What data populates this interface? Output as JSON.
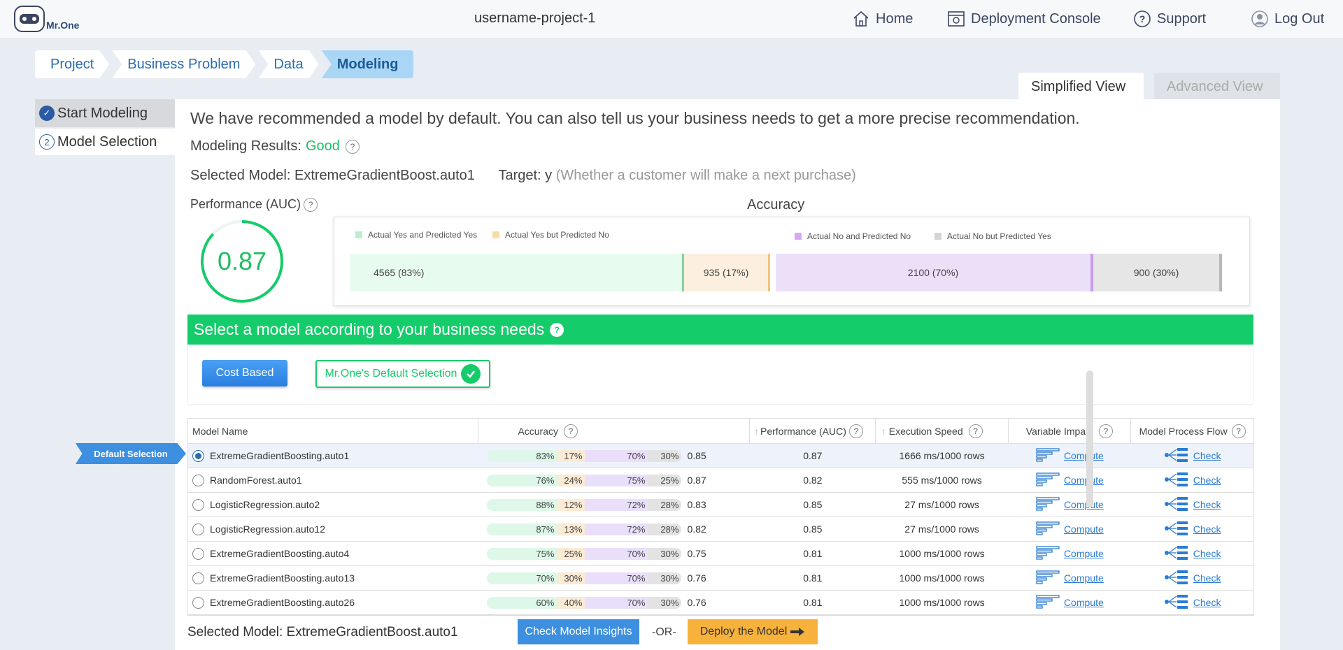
{
  "header": {
    "logo_text": "Mr.One",
    "project_name": "username-project-1",
    "nav": [
      {
        "label": "Home",
        "icon": "home-icon"
      },
      {
        "label": "Deployment Console",
        "icon": "console-icon"
      },
      {
        "label": "Support",
        "icon": "help-icon"
      },
      {
        "label": "Log Out",
        "icon": "user-icon"
      }
    ]
  },
  "breadcrumb": [
    "Project",
    "Business Problem",
    "Data",
    "Modeling"
  ],
  "view_tabs": {
    "simplified": "Simplified View",
    "advanced": "Advanced View"
  },
  "sidenav": [
    {
      "label": "Start Modeling",
      "state": "done"
    },
    {
      "label": "Model Selection",
      "step": "2"
    }
  ],
  "main": {
    "recommendation": "We have recommended a model by default. You can also tell us your business needs to get a more precise recommendation.",
    "results_label": "Modeling Results:",
    "results_value": "Good",
    "selected_model_label": "Selected Model: ExtremeGradientBoost.auto1",
    "target_label": "Target: y",
    "target_desc": "(Whether a customer will make a next purchase)",
    "performance_label": "Performance (AUC)",
    "auc_value": "0.87",
    "auc_fraction": 0.87,
    "accuracy_title": "Accuracy",
    "legend": [
      {
        "label": "Actual Yes and Predicted Yes",
        "color": "#bfeccf"
      },
      {
        "label": "Actual Yes but Predicted No",
        "color": "#f8dca8"
      },
      {
        "label": "Actual No and Predicted No",
        "color": "#d9a8f2"
      },
      {
        "label": "Actual No but Predicted Yes",
        "color": "#d4d4d4"
      }
    ],
    "segments": [
      {
        "text": "4565   (83%)",
        "color": "#e8fbef",
        "edge": "#7ed6a0"
      },
      {
        "text": "935  (17%)",
        "color": "#fcefdf",
        "edge": "#f4c27a"
      },
      {
        "text": "2100  (70%)",
        "color": "#ece0f9",
        "edge": "#c79bf0"
      },
      {
        "text": "900  (30%)",
        "color": "#e6e6e6",
        "edge": "#b8b8b8"
      }
    ]
  },
  "business": {
    "title": "Select a model according to your business needs",
    "cost_button": "Cost Based",
    "default_button": "Mr.One's Default Selection"
  },
  "table": {
    "headers": {
      "name": "Model Name",
      "accuracy": "Accuracy",
      "performance": "Performance (AUC)",
      "speed": "Execution Speed",
      "variable": "Variable Impact",
      "flow": "Model Process Flow"
    },
    "default_flag": "Default Selection",
    "compute_label": "Compute",
    "check_label": "Check",
    "rows": [
      {
        "name": "ExtremeGradientBoosting.auto1",
        "a": "83%",
        "b": "17%",
        "c": "70%",
        "d": "30%",
        "score": "0.85",
        "auc": "0.87",
        "speed": "1666 ms/1000 rows"
      },
      {
        "name": "RandomForest.auto1",
        "a": "76%",
        "b": "24%",
        "c": "75%",
        "d": "25%",
        "score": "0.87",
        "auc": "0.82",
        "speed": "555 ms/1000 rows"
      },
      {
        "name": "LogisticRegression.auto2",
        "a": "88%",
        "b": "12%",
        "c": "72%",
        "d": "28%",
        "score": "0.83",
        "auc": "0.85",
        "speed": "27 ms/1000 rows"
      },
      {
        "name": "LogisticRegression.auto12",
        "a": "87%",
        "b": "13%",
        "c": "72%",
        "d": "28%",
        "score": "0.82",
        "auc": "0.85",
        "speed": "27 ms/1000 rows"
      },
      {
        "name": "ExtremeGradientBoosting.auto4",
        "a": "75%",
        "b": "25%",
        "c": "70%",
        "d": "30%",
        "score": "0.75",
        "auc": "0.81",
        "speed": "1000 ms/1000 rows"
      },
      {
        "name": "ExtremeGradientBoosting.auto13",
        "a": "70%",
        "b": "30%",
        "c": "70%",
        "d": "30%",
        "score": "0.76",
        "auc": "0.81",
        "speed": "1000 ms/1000 rows"
      },
      {
        "name": "ExtremeGradientBoosting.auto26",
        "a": "60%",
        "b": "40%",
        "c": "70%",
        "d": "30%",
        "score": "0.76",
        "auc": "0.81",
        "speed": "1000 ms/1000 rows"
      }
    ]
  },
  "footer": {
    "selected_model": "Selected Model: ExtremeGradientBoost.auto1",
    "insights_button": "Check Model Insights",
    "or_text": "-OR-",
    "deploy_button": "Deploy the Model"
  }
}
